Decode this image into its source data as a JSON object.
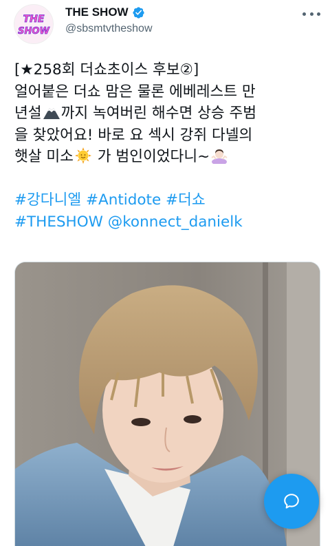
{
  "account": {
    "display_name": "THE SHOW",
    "handle": "@sbsmtvtheshow",
    "avatar_logo": "THE SHOW",
    "verified": true
  },
  "tweet": {
    "line1": "[★258회 더쇼초이스 후보②]",
    "line2": "얼어붙은 더쇼 맘은 물론 에베레스트 만",
    "line3_a": "년설",
    "line3_b": "까지 녹여버린 해수면 상승 주범",
    "line4": "을 찾았어요! 바로 요 섹시 강쥐 다넬의",
    "line5_a": "햇살 미소",
    "line5_b": " 가 범인이었다니~",
    "hashtags_line1": [
      "#강다니엘",
      "#Antidote",
      "#더쇼"
    ],
    "hashtags_line2": [
      "#THESHOW"
    ],
    "mention": "@konnect_danielk"
  },
  "icons": {
    "verified": "verified-badge-icon",
    "more": "more-options-icon",
    "mountain_emoji": "snow-capped-mountain-emoji",
    "sun_emoji": "sun-with-face-emoji",
    "shrug_emoji": "person-shrugging-emoji",
    "compose": "compose-reply-icon"
  },
  "colors": {
    "accent": "#1d9bf0",
    "text": "#0f1419",
    "secondary": "#536471"
  }
}
